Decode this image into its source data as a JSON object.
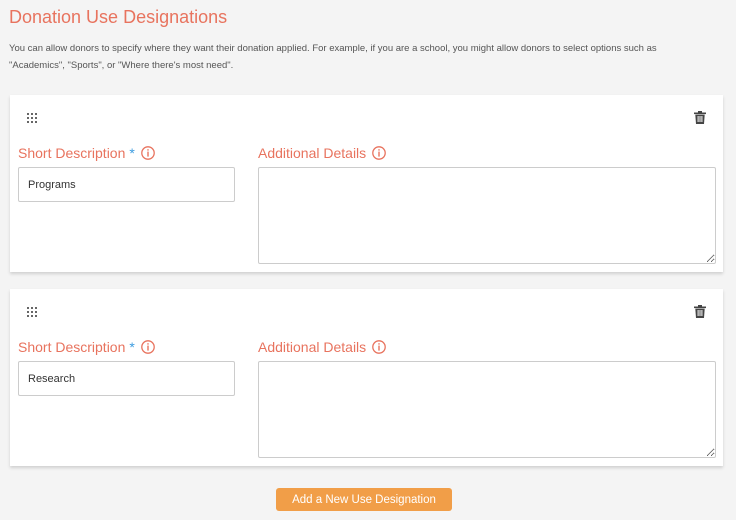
{
  "header": {
    "title": "Donation Use Designations",
    "description": "You can allow donors to specify where they want their donation applied. For example, if you are a school, you might allow donors to select options such as \"Academics\", \"Sports\", or \"Where there's most need\"."
  },
  "designations": [
    {
      "short_label": "Short Description",
      "required_mark": "*",
      "short_value": "Programs",
      "details_label": "Additional Details",
      "details_value": ""
    },
    {
      "short_label": "Short Description",
      "required_mark": "*",
      "short_value": "Research",
      "details_label": "Additional Details",
      "details_value": ""
    }
  ],
  "actions": {
    "add_label": "Add a New Use Designation"
  },
  "icons": {
    "drag": "drag-handle-icon",
    "delete": "trash-icon",
    "info": "info-icon"
  },
  "colors": {
    "accent": "#e8735e",
    "required": "#3c9ce0",
    "button": "#f19e48",
    "background": "#f4f4f4"
  }
}
